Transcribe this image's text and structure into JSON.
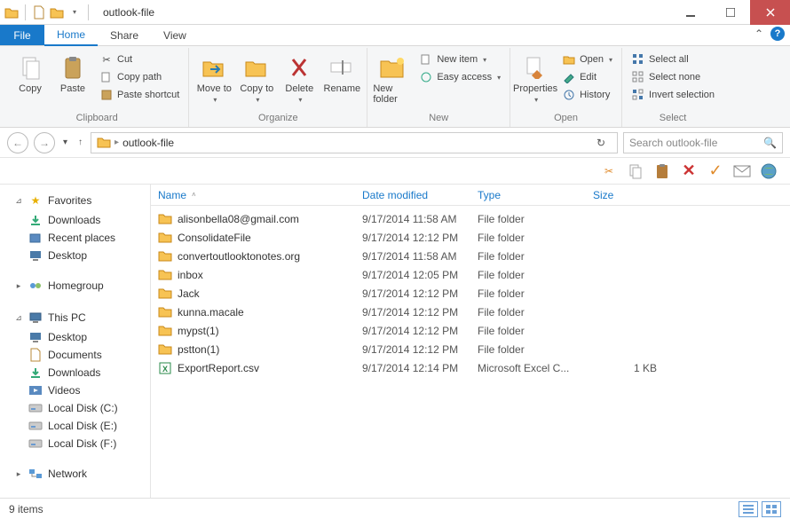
{
  "window": {
    "title": "outlook-file",
    "quick_access": [
      "folder-yellow",
      "doc-new",
      "folder-small"
    ]
  },
  "ribbon_tabs": {
    "file_label": "File",
    "tabs": [
      "Home",
      "Share",
      "View"
    ],
    "active_index": 0
  },
  "ribbon": {
    "groups": {
      "clipboard": {
        "label": "Clipboard",
        "copy": "Copy",
        "paste": "Paste",
        "cut": "Cut",
        "copy_path": "Copy path",
        "paste_shortcut": "Paste shortcut"
      },
      "organize": {
        "label": "Organize",
        "move_to": "Move to",
        "copy_to": "Copy to",
        "delete": "Delete",
        "rename": "Rename"
      },
      "new": {
        "label": "New",
        "new_folder": "New folder",
        "new_item": "New item",
        "easy_access": "Easy access"
      },
      "open": {
        "label": "Open",
        "properties": "Properties",
        "open": "Open",
        "edit": "Edit",
        "history": "History"
      },
      "select": {
        "label": "Select",
        "select_all": "Select all",
        "select_none": "Select none",
        "invert": "Invert selection"
      }
    }
  },
  "address": {
    "path": "outlook-file",
    "search_placeholder": "Search outlook-file"
  },
  "sidebar": {
    "favorites": {
      "label": "Favorites",
      "items": [
        "Downloads",
        "Recent places",
        "Desktop"
      ],
      "icons": [
        "download",
        "recent",
        "desktop"
      ]
    },
    "homegroup": {
      "label": "Homegroup"
    },
    "thispc": {
      "label": "This PC",
      "items": [
        "Desktop",
        "Documents",
        "Downloads",
        "Videos",
        "Local Disk (C:)",
        "Local Disk (E:)",
        "Local Disk (F:)"
      ],
      "icons": [
        "desktop",
        "documents",
        "download",
        "videos",
        "disk",
        "disk",
        "disk"
      ]
    },
    "network": {
      "label": "Network"
    }
  },
  "columns": {
    "name": "Name",
    "date": "Date modified",
    "type": "Type",
    "size": "Size"
  },
  "files": [
    {
      "name": "alisonbella08@gmail.com",
      "date": "9/17/2014 11:58 AM",
      "type": "File folder",
      "size": "",
      "icon": "folder"
    },
    {
      "name": "ConsolidateFile",
      "date": "9/17/2014 12:12 PM",
      "type": "File folder",
      "size": "",
      "icon": "folder"
    },
    {
      "name": "convertoutlooktonotes.org",
      "date": "9/17/2014 11:58 AM",
      "type": "File folder",
      "size": "",
      "icon": "folder"
    },
    {
      "name": "inbox",
      "date": "9/17/2014 12:05 PM",
      "type": "File folder",
      "size": "",
      "icon": "folder"
    },
    {
      "name": "Jack",
      "date": "9/17/2014 12:12 PM",
      "type": "File folder",
      "size": "",
      "icon": "folder"
    },
    {
      "name": "kunna.macale",
      "date": "9/17/2014 12:12 PM",
      "type": "File folder",
      "size": "",
      "icon": "folder"
    },
    {
      "name": "mypst(1)",
      "date": "9/17/2014 12:12 PM",
      "type": "File folder",
      "size": "",
      "icon": "folder"
    },
    {
      "name": "pstton(1)",
      "date": "9/17/2014 12:12 PM",
      "type": "File folder",
      "size": "",
      "icon": "folder"
    },
    {
      "name": "ExportReport.csv",
      "date": "9/17/2014 12:14 PM",
      "type": "Microsoft Excel C...",
      "size": "1 KB",
      "icon": "excel"
    }
  ],
  "status": {
    "item_count": "9 items"
  }
}
